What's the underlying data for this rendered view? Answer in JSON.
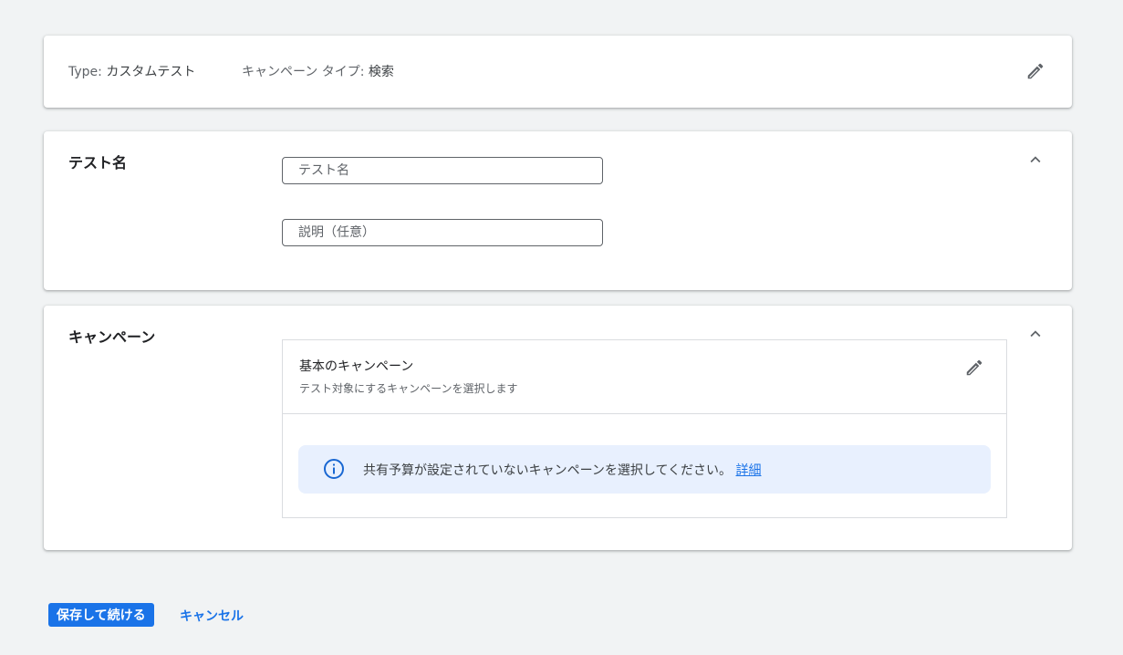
{
  "summary": {
    "type_label": "Type:",
    "type_value": "カスタムテスト",
    "campaign_type_label": "キャンペーン タイプ:",
    "campaign_type_value": "検索",
    "edit_icon": "pencil-icon"
  },
  "test_name_section": {
    "title": "テスト名",
    "name_placeholder": "テスト名",
    "name_value": "",
    "description_placeholder": "説明（任意）",
    "description_value": "",
    "collapse_icon": "chevron-up-icon"
  },
  "campaign_section": {
    "title": "キャンペーン",
    "collapse_icon": "chevron-up-icon",
    "base_campaign": {
      "title": "基本のキャンペーン",
      "subtitle": "テスト対象にするキャンペーンを選択します",
      "edit_icon": "pencil-icon"
    },
    "info_banner": {
      "icon": "info-icon",
      "message": "共有予算が設定されていないキャンペーンを選択してください。",
      "link_text": "詳細"
    }
  },
  "actions": {
    "save_label": "保存して続ける",
    "cancel_label": "キャンセル"
  },
  "colors": {
    "background": "#f1f3f4",
    "primary": "#1a73e8",
    "info_banner_bg": "#e8f0fe"
  }
}
